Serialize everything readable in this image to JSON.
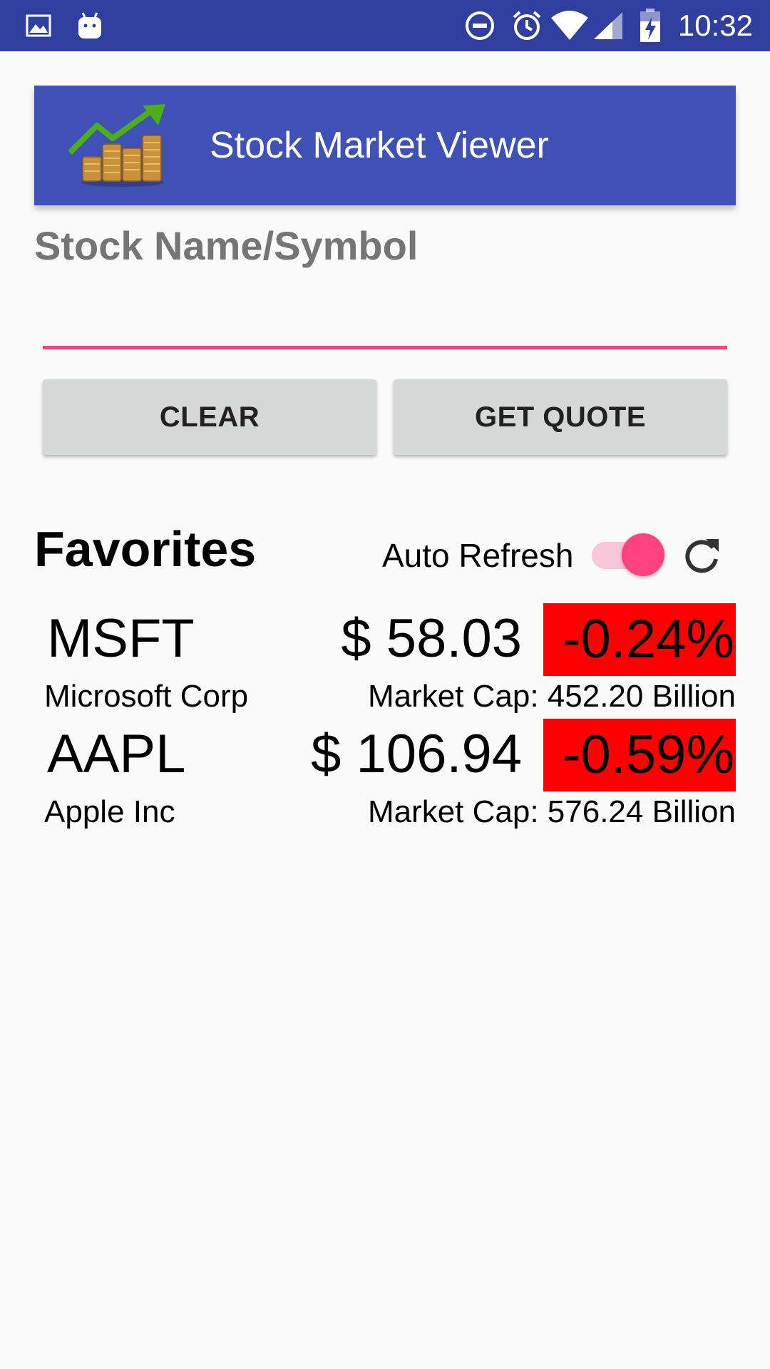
{
  "status_bar": {
    "time": "10:32",
    "icons": [
      "image-icon",
      "android-icon",
      "do-not-disturb-icon",
      "alarm-icon",
      "wifi-icon",
      "signal-icon",
      "battery-charging-icon"
    ]
  },
  "header": {
    "title": "Stock Market Viewer",
    "logo": "stock-coins-logo"
  },
  "search": {
    "label": "Stock Name/Symbol",
    "value": "",
    "placeholder": ""
  },
  "buttons": {
    "clear": "CLEAR",
    "get_quote": "GET QUOTE"
  },
  "favorites": {
    "title": "Favorites",
    "auto_refresh_label": "Auto Refresh",
    "auto_refresh_on": true,
    "refresh_icon": "refresh-icon",
    "items": [
      {
        "symbol": "MSFT",
        "price": "$ 58.03",
        "change": "-0.24%",
        "company": "Microsoft Corp",
        "market_cap": "Market Cap: 452.20 Billion"
      },
      {
        "symbol": "AAPL",
        "price": "$ 106.94",
        "change": "-0.59%",
        "company": "Apple Inc",
        "market_cap": "Market Cap: 576.24 Billion"
      }
    ]
  },
  "colors": {
    "status_bar": "#303f9f",
    "primary": "#3f51b5",
    "accent": "#ff4081",
    "negative_change": "#ff0000"
  }
}
